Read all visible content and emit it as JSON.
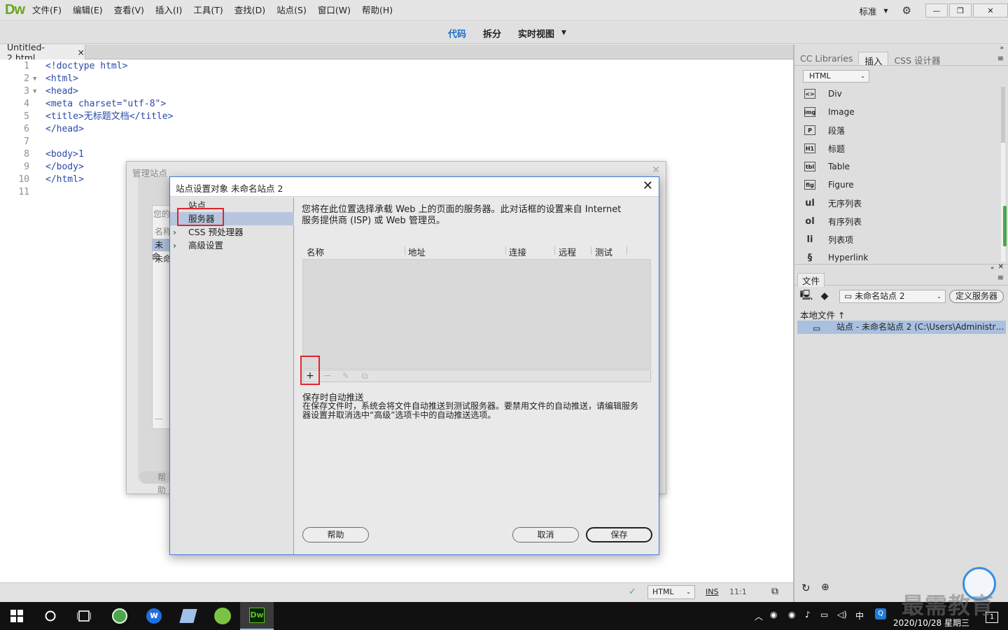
{
  "app": {
    "logo": "Dw",
    "menu": [
      "文件(F)",
      "编辑(E)",
      "查看(V)",
      "插入(I)",
      "工具(T)",
      "查找(D)",
      "站点(S)",
      "窗口(W)",
      "帮助(H)"
    ],
    "workspace": "标准",
    "window_buttons": [
      "—",
      "❐",
      "✕"
    ]
  },
  "viewbar": {
    "code": "代码",
    "split": "拆分",
    "live": "实时视图"
  },
  "document": {
    "tab": "Untitled-2.html",
    "tab_close": "×",
    "lines": [
      {
        "n": "1",
        "fold": "",
        "text": "<!doctype html>"
      },
      {
        "n": "2",
        "fold": "▼",
        "text": "<html>"
      },
      {
        "n": "3",
        "fold": "▼",
        "text": "<head>"
      },
      {
        "n": "4",
        "fold": "",
        "text": "<meta charset=\"utf-8\">"
      },
      {
        "n": "5",
        "fold": "",
        "text": "<title>无标题文档</title>"
      },
      {
        "n": "6",
        "fold": "",
        "text": "</head>"
      },
      {
        "n": "7",
        "fold": "",
        "text": ""
      },
      {
        "n": "8",
        "fold": "",
        "text": "<body>1"
      },
      {
        "n": "9",
        "fold": "",
        "text": "</body>"
      },
      {
        "n": "10",
        "fold": "",
        "text": "</html>"
      },
      {
        "n": "11",
        "fold": "",
        "text": ""
      }
    ]
  },
  "statusbar": {
    "mode": "HTML",
    "ins": "INS",
    "pos": "11:1"
  },
  "insert_panel": {
    "tabs": [
      "CC Libraries",
      "插入",
      "CSS 设计器"
    ],
    "category": "HTML",
    "items": [
      {
        "icon": "<>",
        "label": "Div"
      },
      {
        "icon": "img",
        "label": "Image"
      },
      {
        "icon": "P",
        "label": "段落"
      },
      {
        "icon": "H1",
        "label": "标题"
      },
      {
        "icon": "tbl",
        "label": "Table"
      },
      {
        "icon": "fig",
        "label": "Figure"
      },
      {
        "icon": "ul",
        "label": "无序列表"
      },
      {
        "icon": "ol",
        "label": "有序列表"
      },
      {
        "icon": "li",
        "label": "列表项"
      },
      {
        "icon": "§",
        "label": "Hyperlink"
      }
    ]
  },
  "files_panel": {
    "tab": "文件",
    "site": "未命名站点 2",
    "define_server": "定义服务器",
    "local_files": "本地文件",
    "site_row": "站点 - 未命名站点 2 (C:\\Users\\Administrator\\..."
  },
  "manage_sites": {
    "title": "管理站点",
    "labels": [
      "您的",
      "名称",
      "未命",
      "未命",
      "帮助"
    ]
  },
  "site_setup": {
    "title": "站点设置对象 未命名站点 2",
    "nav": [
      {
        "label": "站点",
        "chev": ""
      },
      {
        "label": "服务器",
        "chev": ""
      },
      {
        "label": "CSS 预处理器",
        "chev": "›"
      },
      {
        "label": "高级设置",
        "chev": "›"
      }
    ],
    "intro": "您将在此位置选择承载 Web 上的页面的服务器。此对话框的设置来自 Internet 服务提供商 (ISP) 或 Web 管理员。",
    "columns": [
      "名称",
      "地址",
      "连接",
      "远程",
      "测试"
    ],
    "toolbar": [
      "+",
      "−",
      "✎",
      "⧉"
    ],
    "autopush_title": "保存时自动推送",
    "autopush_desc": "在保存文件时，系统会将文件自动推送到测试服务器。要禁用文件的自动推送，请编辑服务器设置并取消选中“高级”选项卡中的自动推送选项。",
    "buttons": {
      "help": "帮助",
      "cancel": "取消",
      "save": "保存"
    }
  },
  "taskbar": {
    "datetime": "2020/10/28 星期三",
    "ime": "中",
    "badge": "1"
  },
  "watermark": "最需教育"
}
